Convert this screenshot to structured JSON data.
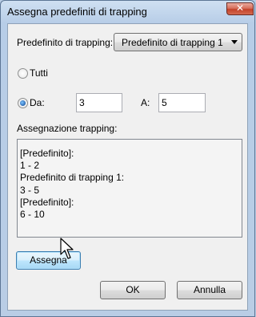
{
  "window": {
    "title": "Assegna predefiniti di trapping",
    "close_glyph": "✕"
  },
  "preset": {
    "label": "Predefinito di trapping:",
    "selected": "Predefinito di trapping 1"
  },
  "range_options": {
    "all_label": "Tutti",
    "from_label": "Da:",
    "from_value": "3",
    "to_label": "A:",
    "to_value": "5",
    "selected": "Da"
  },
  "assignment": {
    "label": "Assegnazione trapping:",
    "lines": [
      "[Predefinito]:",
      "1 - 2",
      "Predefinito di trapping 1:",
      "3 - 5",
      "[Predefinito]:",
      "6 - 10"
    ]
  },
  "buttons": {
    "assign": "Assegna",
    "ok": "OK",
    "cancel": "Annulla"
  },
  "colors": {
    "title_bar": "#b9cde5",
    "close_button": "#c3422a",
    "dialog_bg": "#f0f0f0",
    "radio_selected": "#1d5aa6"
  },
  "icons": {
    "close": "close-icon",
    "dropdown": "chevron-down-icon",
    "pointer": "mouse-pointer-icon"
  }
}
